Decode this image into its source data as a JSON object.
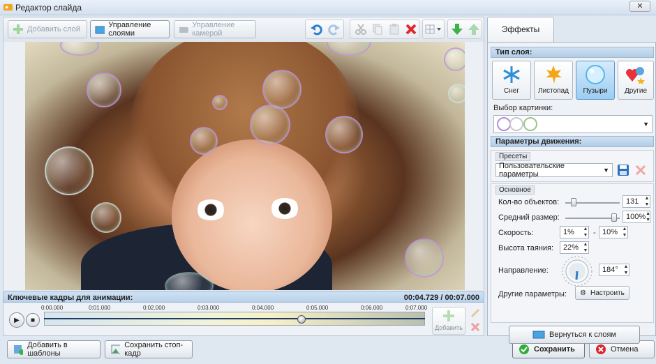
{
  "window": {
    "title": "Редактор слайда",
    "close_glyph": "✕"
  },
  "toolbar": {
    "add_layer": "Добавить слой",
    "manage_layers": "Управление слоями",
    "manage_camera": "Управление камерой",
    "icons": [
      "undo-icon",
      "redo-icon",
      "cut-icon",
      "copy-icon",
      "paste-icon",
      "delete-icon",
      "grid-icon",
      "move-down-icon",
      "move-up-icon"
    ]
  },
  "timeline": {
    "title": "Ключевые кадры для анимации:",
    "time": "00:04.729 / 00:07.000",
    "ticks": [
      "0:00.000",
      "0:01.000",
      "0:02.000",
      "0:03.000",
      "0:04.000",
      "0:05.000",
      "0:06.000",
      "0:07.000"
    ],
    "position_fraction": 0.6756,
    "add_label": "Добавить"
  },
  "bottom": {
    "add_template": "Добавить в шаблоны",
    "save_frame": "Сохранить стоп-кадр",
    "save": "Сохранить",
    "cancel": "Отмена"
  },
  "panel": {
    "tab": "Эффекты",
    "layer_type_header": "Тип слоя:",
    "types": [
      {
        "label": "Снег",
        "glyph": "❄"
      },
      {
        "label": "Листопад",
        "glyph": "🍁"
      },
      {
        "label": "Пузыри",
        "glyph": "◯"
      },
      {
        "label": "Другие",
        "glyph": "❤"
      }
    ],
    "selected_type": "Пузыри",
    "picture_choice_label": "Выбор картинки:",
    "motion_header": "Параметры движения:",
    "presets_label": "Пресеты",
    "preset_value": "Пользовательские параметры",
    "basic_label": "Основное",
    "count_label": "Кол-во объектов:",
    "count_value": "131",
    "size_label": "Средний размер:",
    "size_value": "100%",
    "speed_label": "Скорость:",
    "speed_from": "1%",
    "speed_sep": "-",
    "speed_to": "10%",
    "melt_label": "Высота таяния:",
    "melt_value": "22%",
    "direction_label": "Направление:",
    "direction_value": "184°",
    "other_label": "Другие параметры:",
    "configure_button": "Настроить",
    "back_button": "Вернуться к слоям"
  },
  "colors": {
    "accent": "#3d8fd6",
    "header_blue": "#b8d2ea",
    "save_green": "#2fae3a",
    "cancel_red": "#d8262a"
  }
}
